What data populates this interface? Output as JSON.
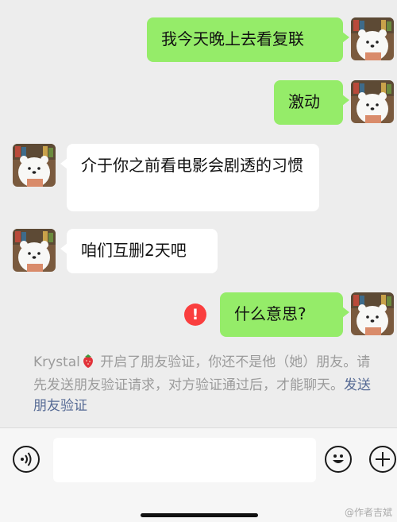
{
  "messages": [
    {
      "side": "me",
      "text": "我今天晚上去看复联"
    },
    {
      "side": "me",
      "text": "激动"
    },
    {
      "side": "them",
      "text": "介于你之前看电影会剧透的习惯"
    },
    {
      "side": "them",
      "text": "咱们互删2天吧"
    },
    {
      "side": "me",
      "text": "什么意思?",
      "failed": true
    }
  ],
  "system_notice": {
    "name": "Krystal",
    "text": " 开启了朋友验证，你还不是他（她）朋友。请先发送朋友验证请求，对方验证通过后，才能聊天。",
    "link": "发送朋友验证"
  },
  "input_bar": {
    "placeholder": "",
    "icons": [
      "voice-icon",
      "emoji-icon",
      "plus-icon"
    ]
  },
  "watermark": "@作者吉斌",
  "colors": {
    "background": "#ededed",
    "my_bubble": "#95ec69",
    "their_bubble": "#ffffff",
    "error": "#fa3e3e",
    "link": "#576b95"
  }
}
